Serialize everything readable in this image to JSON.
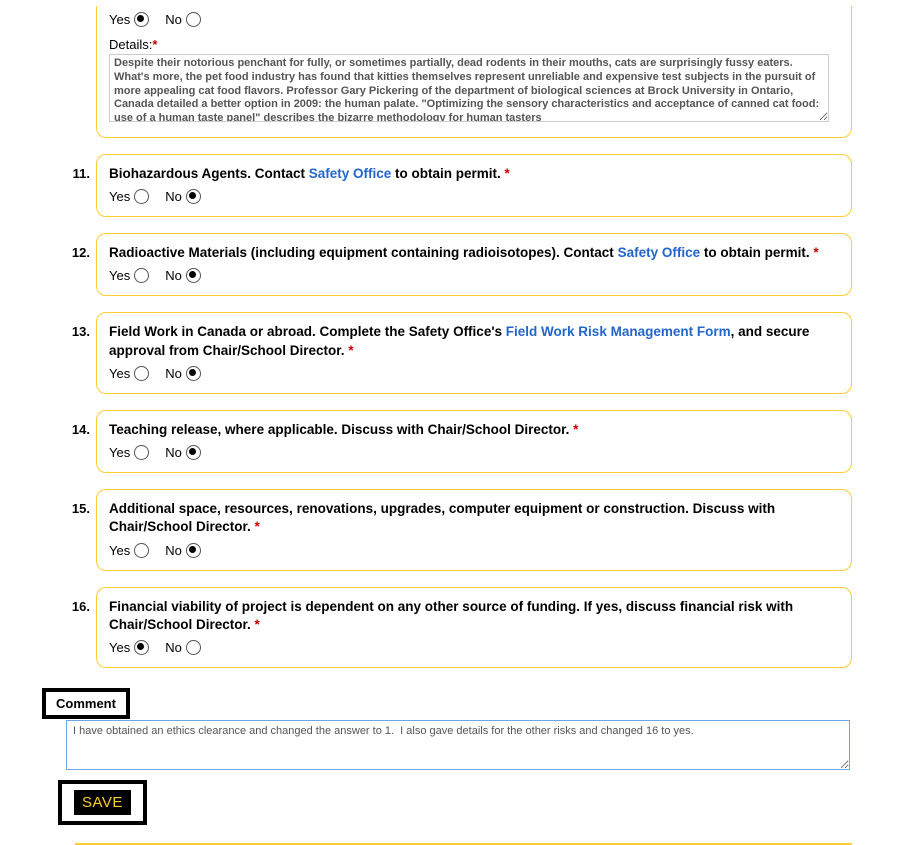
{
  "q10": {
    "yes_label": "Yes",
    "no_label": "No",
    "selected": "yes",
    "details_label": "Details:",
    "details_value": "Despite their notorious penchant for fully, or sometimes partially, dead rodents in their mouths, cats are surprisingly fussy eaters. What's more, the pet food industry has found that kitties themselves represent unreliable and expensive test subjects in the pursuit of more appealing cat food flavors. Professor Gary Pickering of the department of biological sciences at Brock University in Ontario, Canada detailed a better option in 2009: the human palate. \"Optimizing the sensory characteristics and acceptance of canned cat food: use of a human taste panel\" describes the bizarre methodology for human tasters"
  },
  "questions": [
    {
      "num": "11.",
      "parts": [
        {
          "text": "Biohazardous Agents. Contact ",
          "bold": true
        },
        {
          "text": "Safety Office",
          "link": true
        },
        {
          "text": " to obtain permit. ",
          "bold": true
        }
      ],
      "selected": "no"
    },
    {
      "num": "12.",
      "parts": [
        {
          "text": "Radioactive Materials (including equipment containing radioisotopes). Contact ",
          "bold": true
        },
        {
          "text": "Safety Office",
          "link": true
        },
        {
          "text": " to obtain permit. ",
          "bold": true
        }
      ],
      "selected": "no"
    },
    {
      "num": "13.",
      "parts": [
        {
          "text": "Field Work in Canada or abroad. Complete the Safety Office's ",
          "bold": true
        },
        {
          "text": "Field Work Risk Management Form",
          "link": true
        },
        {
          "text": ", and secure approval from Chair/School Director. ",
          "bold": true
        }
      ],
      "selected": "no"
    },
    {
      "num": "14.",
      "parts": [
        {
          "text": "Teaching release, where applicable. Discuss with Chair/School Director. ",
          "bold": true
        }
      ],
      "selected": "no"
    },
    {
      "num": "15.",
      "parts": [
        {
          "text": "Additional space, resources, renovations, upgrades, computer equipment or construction. Discuss with Chair/School Director. ",
          "bold": true
        }
      ],
      "selected": "no"
    },
    {
      "num": "16.",
      "parts": [
        {
          "text": "Financial viability of project is dependent on any other source of funding. If yes, discuss financial risk with Chair/School Director. ",
          "bold": true
        }
      ],
      "selected": "yes"
    }
  ],
  "yn": {
    "yes": "Yes",
    "no": "No"
  },
  "comment": {
    "label": "Comment",
    "value": "I have obtained an ethics clearance and changed the answer to 1.  I also gave details for the other risks and changed 16 to yes."
  },
  "save_label": "SAVE"
}
